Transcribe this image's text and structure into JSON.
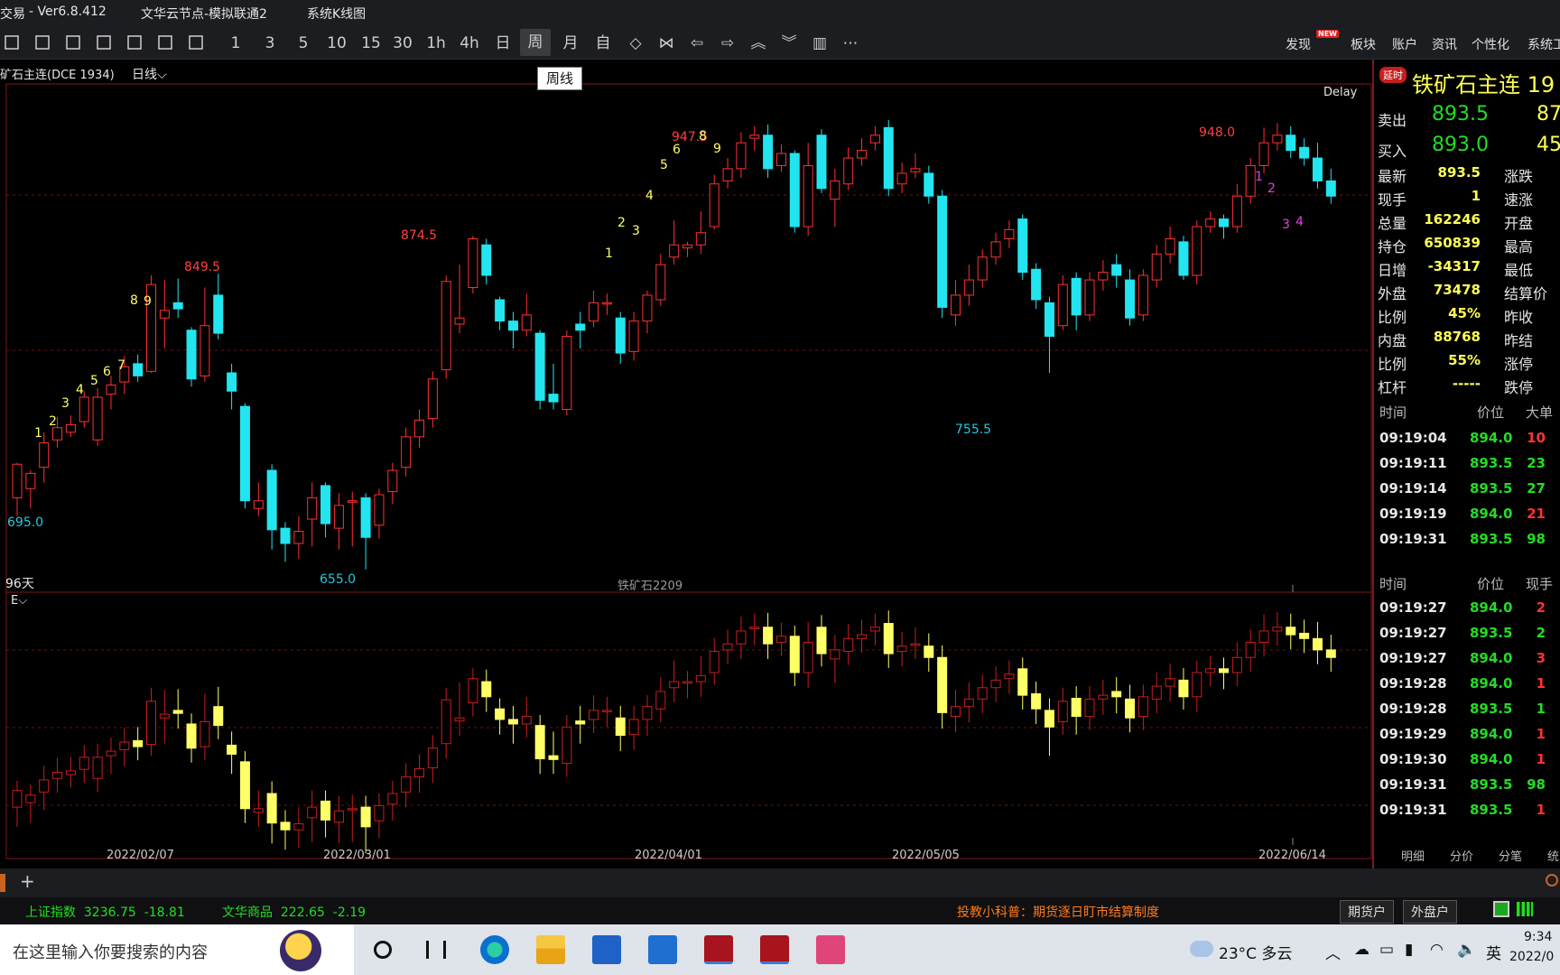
{
  "app": {
    "title_parts": [
      "交易",
      "- Ver6.8.412",
      "文华云节点-模拟联通2",
      "系统K线图"
    ]
  },
  "toolbar": {
    "periods": [
      "1",
      "3",
      "5",
      "10",
      "15",
      "30",
      "1h",
      "4h",
      "日",
      "周",
      "月",
      "自"
    ],
    "tooltip": "周线",
    "right": {
      "discover": "发现",
      "new_badge": "NEW",
      "sectors": "板块",
      "account": "账户",
      "news": "资讯",
      "personalize": "个性化",
      "system": "系统工"
    }
  },
  "chart": {
    "instrument": "矿石主连(DCE 1934)",
    "period": "日线",
    "delay": "Delay",
    "days": "96天",
    "contract": "铁矿石2209",
    "indicator": "E",
    "dates": [
      "2022/02/07",
      "2022/03/01",
      "2022/04/01",
      "2022/05/05",
      "2022/06/14"
    ],
    "annotations": {
      "high1": "849.5",
      "high2": "874.5",
      "high3": "947.5",
      "high4": "948.0",
      "low1": "695.0",
      "low2": "655.0",
      "low3": "755.5"
    }
  },
  "chart_data": {
    "type": "candlestick",
    "series": [
      {
        "o": 702,
        "c": 724,
        "h": 725,
        "l": 690
      },
      {
        "o": 708,
        "c": 718,
        "h": 720,
        "l": 695
      },
      {
        "o": 722,
        "c": 738,
        "h": 745,
        "l": 712
      },
      {
        "o": 740,
        "c": 748,
        "h": 755,
        "l": 735
      },
      {
        "o": 745,
        "c": 750,
        "h": 756,
        "l": 742
      },
      {
        "o": 752,
        "c": 768,
        "h": 772,
        "l": 748
      },
      {
        "o": 740,
        "c": 768,
        "h": 774,
        "l": 736
      },
      {
        "o": 770,
        "c": 776,
        "h": 782,
        "l": 760
      },
      {
        "o": 778,
        "c": 788,
        "h": 795,
        "l": 770
      },
      {
        "o": 790,
        "c": 782,
        "h": 796,
        "l": 778
      },
      {
        "o": 785,
        "c": 842,
        "h": 848,
        "l": 784
      },
      {
        "o": 820,
        "c": 825,
        "h": 845,
        "l": 800
      },
      {
        "o": 830,
        "c": 826,
        "h": 846,
        "l": 820
      },
      {
        "o": 812,
        "c": 780,
        "h": 814,
        "l": 775
      },
      {
        "o": 782,
        "c": 815,
        "h": 840,
        "l": 778
      },
      {
        "o": 835,
        "c": 810,
        "h": 849,
        "l": 806
      },
      {
        "o": 784,
        "c": 772,
        "h": 790,
        "l": 760
      },
      {
        "o": 762,
        "c": 700,
        "h": 764,
        "l": 695
      },
      {
        "o": 695,
        "c": 700,
        "h": 712,
        "l": 690
      },
      {
        "o": 720,
        "c": 681,
        "h": 724,
        "l": 668
      },
      {
        "o": 682,
        "c": 672,
        "h": 686,
        "l": 660
      },
      {
        "o": 672,
        "c": 680,
        "h": 690,
        "l": 662
      },
      {
        "o": 688,
        "c": 702,
        "h": 712,
        "l": 670
      },
      {
        "o": 710,
        "c": 685,
        "h": 712,
        "l": 676
      },
      {
        "o": 682,
        "c": 697,
        "h": 705,
        "l": 668
      },
      {
        "o": 700,
        "c": 700,
        "h": 706,
        "l": 670
      },
      {
        "o": 702,
        "c": 676,
        "h": 705,
        "l": 655
      },
      {
        "o": 684,
        "c": 704,
        "h": 708,
        "l": 675
      },
      {
        "o": 706,
        "c": 720,
        "h": 725,
        "l": 698
      },
      {
        "o": 722,
        "c": 742,
        "h": 748,
        "l": 716
      },
      {
        "o": 742,
        "c": 753,
        "h": 760,
        "l": 735
      },
      {
        "o": 754,
        "c": 780,
        "h": 785,
        "l": 748
      },
      {
        "o": 786,
        "c": 844,
        "h": 848,
        "l": 780
      },
      {
        "o": 816,
        "c": 820,
        "h": 855,
        "l": 810
      },
      {
        "o": 840,
        "c": 872,
        "h": 874,
        "l": 836
      },
      {
        "o": 868,
        "c": 848,
        "h": 872,
        "l": 842
      },
      {
        "o": 832,
        "c": 818,
        "h": 834,
        "l": 812
      },
      {
        "o": 818,
        "c": 812,
        "h": 824,
        "l": 800
      },
      {
        "o": 812,
        "c": 822,
        "h": 836,
        "l": 808
      },
      {
        "o": 810,
        "c": 766,
        "h": 812,
        "l": 760
      },
      {
        "o": 770,
        "c": 765,
        "h": 790,
        "l": 760
      },
      {
        "o": 760,
        "c": 808,
        "h": 812,
        "l": 756
      },
      {
        "o": 816,
        "c": 812,
        "h": 824,
        "l": 800
      },
      {
        "o": 818,
        "c": 830,
        "h": 838,
        "l": 814
      },
      {
        "o": 830,
        "c": 830,
        "h": 836,
        "l": 822
      },
      {
        "o": 820,
        "c": 797,
        "h": 824,
        "l": 790
      },
      {
        "o": 798,
        "c": 818,
        "h": 824,
        "l": 792
      },
      {
        "o": 818,
        "c": 835,
        "h": 838,
        "l": 810
      },
      {
        "o": 832,
        "c": 855,
        "h": 862,
        "l": 828
      },
      {
        "o": 860,
        "c": 868,
        "h": 884,
        "l": 855
      },
      {
        "o": 866,
        "c": 868,
        "h": 870,
        "l": 860
      },
      {
        "o": 868,
        "c": 876,
        "h": 890,
        "l": 862
      },
      {
        "o": 880,
        "c": 908,
        "h": 914,
        "l": 878
      },
      {
        "o": 910,
        "c": 918,
        "h": 925,
        "l": 905
      },
      {
        "o": 918,
        "c": 935,
        "h": 942,
        "l": 912
      },
      {
        "o": 938,
        "c": 940,
        "h": 946,
        "l": 930
      },
      {
        "o": 940,
        "c": 918,
        "h": 947,
        "l": 912
      },
      {
        "o": 920,
        "c": 928,
        "h": 934,
        "l": 916
      },
      {
        "o": 928,
        "c": 880,
        "h": 930,
        "l": 876
      },
      {
        "o": 880,
        "c": 920,
        "h": 935,
        "l": 874
      },
      {
        "o": 940,
        "c": 905,
        "h": 944,
        "l": 902
      },
      {
        "o": 898,
        "c": 910,
        "h": 918,
        "l": 880
      },
      {
        "o": 908,
        "c": 925,
        "h": 932,
        "l": 904
      },
      {
        "o": 925,
        "c": 930,
        "h": 938,
        "l": 920
      },
      {
        "o": 935,
        "c": 940,
        "h": 946,
        "l": 930
      },
      {
        "o": 945,
        "c": 905,
        "h": 950,
        "l": 900
      },
      {
        "o": 908,
        "c": 915,
        "h": 922,
        "l": 902
      },
      {
        "o": 916,
        "c": 918,
        "h": 928,
        "l": 912
      },
      {
        "o": 915,
        "c": 900,
        "h": 920,
        "l": 895
      },
      {
        "o": 900,
        "c": 827,
        "h": 904,
        "l": 820
      },
      {
        "o": 822,
        "c": 835,
        "h": 845,
        "l": 815
      },
      {
        "o": 835,
        "c": 845,
        "h": 855,
        "l": 828
      },
      {
        "o": 845,
        "c": 860,
        "h": 865,
        "l": 840
      },
      {
        "o": 860,
        "c": 870,
        "h": 876,
        "l": 855
      },
      {
        "o": 872,
        "c": 878,
        "h": 884,
        "l": 866
      },
      {
        "o": 885,
        "c": 850,
        "h": 888,
        "l": 845
      },
      {
        "o": 852,
        "c": 832,
        "h": 856,
        "l": 826
      },
      {
        "o": 830,
        "c": 808,
        "h": 834,
        "l": 784
      },
      {
        "o": 815,
        "c": 842,
        "h": 848,
        "l": 812
      },
      {
        "o": 846,
        "c": 822,
        "h": 850,
        "l": 812
      },
      {
        "o": 822,
        "c": 845,
        "h": 850,
        "l": 818
      },
      {
        "o": 845,
        "c": 850,
        "h": 858,
        "l": 838
      },
      {
        "o": 855,
        "c": 848,
        "h": 862,
        "l": 840
      },
      {
        "o": 845,
        "c": 820,
        "h": 852,
        "l": 815
      },
      {
        "o": 822,
        "c": 848,
        "h": 852,
        "l": 818
      },
      {
        "o": 845,
        "c": 862,
        "h": 868,
        "l": 840
      },
      {
        "o": 862,
        "c": 872,
        "h": 880,
        "l": 856
      },
      {
        "o": 870,
        "c": 848,
        "h": 874,
        "l": 845
      },
      {
        "o": 848,
        "c": 880,
        "h": 884,
        "l": 842
      },
      {
        "o": 880,
        "c": 885,
        "h": 890,
        "l": 876
      },
      {
        "o": 885,
        "c": 880,
        "h": 888,
        "l": 872
      },
      {
        "o": 880,
        "c": 900,
        "h": 908,
        "l": 876
      },
      {
        "o": 900,
        "c": 920,
        "h": 925,
        "l": 895
      },
      {
        "o": 920,
        "c": 935,
        "h": 945,
        "l": 915
      },
      {
        "o": 935,
        "c": 940,
        "h": 948,
        "l": 930
      },
      {
        "o": 940,
        "c": 930,
        "h": 946,
        "l": 925
      },
      {
        "o": 932,
        "c": 925,
        "h": 938,
        "l": 920
      },
      {
        "o": 925,
        "c": 910,
        "h": 935,
        "l": 905
      },
      {
        "o": 910,
        "c": 900,
        "h": 918,
        "l": 895
      }
    ]
  },
  "quote": {
    "delay_badge": "延时",
    "title": "铁矿石主连 19",
    "sell_label": "卖出",
    "sell_price": "893.5",
    "sell_vol": "87",
    "buy_label": "买入",
    "buy_price": "893.0",
    "buy_vol": "45",
    "stats": [
      {
        "l": "最新",
        "v": "893.5",
        "r": "涨跌"
      },
      {
        "l": "现手",
        "v": "1",
        "r": "速涨"
      },
      {
        "l": "总量",
        "v": "162246",
        "r": "开盘"
      },
      {
        "l": "持仓",
        "v": "650839",
        "r": "最高"
      },
      {
        "l": "日增",
        "v": "-34317",
        "r": "最低"
      },
      {
        "l": "外盘",
        "v": "73478",
        "r": "结算价"
      },
      {
        "l": "比例",
        "v": "45%",
        "r": "昨收"
      },
      {
        "l": "内盘",
        "v": "88768",
        "r": "昨结"
      },
      {
        "l": "比例",
        "v": "55%",
        "r": "涨停"
      },
      {
        "l": "杠杆",
        "v": "-----",
        "r": "跌停"
      }
    ],
    "big_head": [
      "时间",
      "价位",
      "大单"
    ],
    "big": [
      {
        "t": "09:19:04",
        "p": "894.0",
        "v": "10",
        "c": "#ff3333"
      },
      {
        "t": "09:19:11",
        "p": "893.5",
        "v": "23",
        "c": "#22dd22"
      },
      {
        "t": "09:19:14",
        "p": "893.5",
        "v": "27",
        "c": "#22dd22"
      },
      {
        "t": "09:19:19",
        "p": "894.0",
        "v": "21",
        "c": "#ff3333"
      },
      {
        "t": "09:19:31",
        "p": "893.5",
        "v": "98",
        "c": "#22dd22"
      }
    ],
    "tick_head": [
      "时间",
      "价位",
      "现手"
    ],
    "ticks": [
      {
        "t": "09:19:27",
        "p": "894.0",
        "v": "2",
        "c": "#ff3333"
      },
      {
        "t": "09:19:27",
        "p": "893.5",
        "v": "2",
        "c": "#22dd22"
      },
      {
        "t": "09:19:27",
        "p": "894.0",
        "v": "3",
        "c": "#ff3333"
      },
      {
        "t": "09:19:28",
        "p": "894.0",
        "v": "1",
        "c": "#ff3333"
      },
      {
        "t": "09:19:28",
        "p": "893.5",
        "v": "1",
        "c": "#22dd22"
      },
      {
        "t": "09:19:29",
        "p": "894.0",
        "v": "1",
        "c": "#ff3333"
      },
      {
        "t": "09:19:30",
        "p": "894.0",
        "v": "1",
        "c": "#ff3333"
      },
      {
        "t": "09:19:31",
        "p": "893.5",
        "v": "98",
        "c": "#22dd22"
      },
      {
        "t": "09:19:31",
        "p": "893.5",
        "v": "1",
        "c": "#ff3333"
      }
    ],
    "tabs": [
      "明细",
      "分价",
      "分笔",
      "统"
    ]
  },
  "statusbar": {
    "index1": "上证指数  3236.75  -18.81",
    "index2": "文华商品  222.65  -2.19",
    "notice": "投教小科普：期货逐日盯市结算制度",
    "btn1": "期货户",
    "btn2": "外盘户"
  },
  "taskbar": {
    "search": "在这里输入你要搜索的内容",
    "weather": "23°C 多云",
    "ime": "英",
    "time": "9:34",
    "date": "2022/0"
  }
}
